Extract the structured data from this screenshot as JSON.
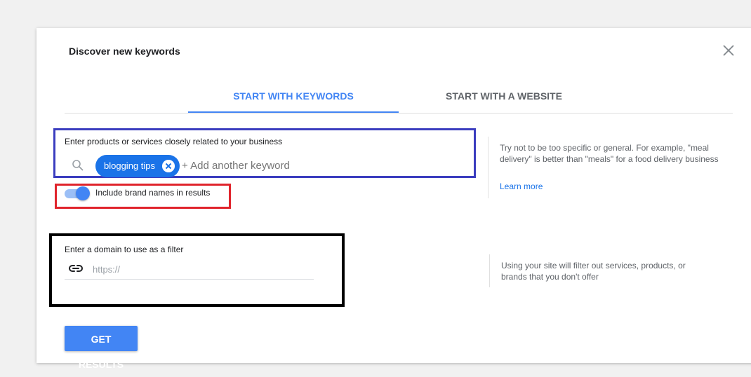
{
  "dialog": {
    "title": "Discover new keywords",
    "close_icon": "close-icon"
  },
  "tabs": [
    {
      "label": "START WITH KEYWORDS",
      "active": true
    },
    {
      "label": "START WITH A WEBSITE",
      "active": false
    }
  ],
  "keywords": {
    "label": "Enter products or services closely related to your business",
    "search_icon": "search-icon",
    "chips": [
      {
        "label": "blogging tips"
      }
    ],
    "add_placeholder": "+ Add another keyword"
  },
  "brand_toggle": {
    "label": "Include brand names in results",
    "on": true
  },
  "keywords_hint": {
    "text": "Try not to be too specific or general. For example, \"meal delivery\" is better than \"meals\" for a food delivery business",
    "learn_more": "Learn more"
  },
  "domain": {
    "label": "Enter a domain to use as a filter",
    "icon": "link-icon",
    "placeholder": "https://"
  },
  "domain_hint": {
    "text": "Using your site will filter out services, products, or brands that you don't offer"
  },
  "actions": {
    "get_results": "GET RESULTS"
  },
  "colors": {
    "accent": "#4285f4",
    "chip": "#1a73e8",
    "highlight_blue": "#3b3dbf",
    "highlight_red": "#e0242c",
    "highlight_black": "#000000"
  }
}
